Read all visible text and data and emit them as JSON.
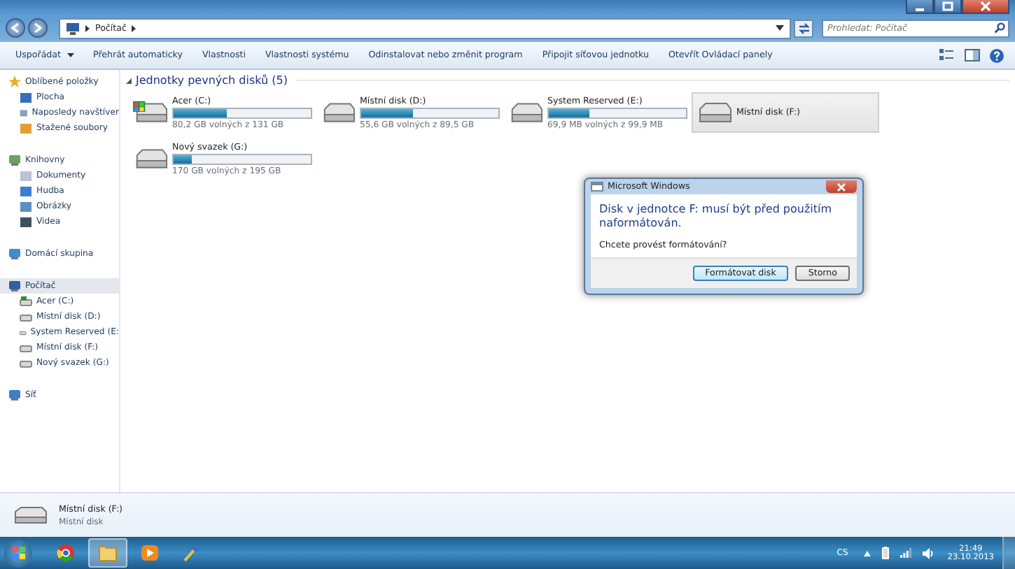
{
  "address_bar": {
    "path": "Počítač",
    "search_placeholder": "Prohledat: Počítač"
  },
  "toolbar": {
    "buttons": [
      {
        "label": "Uspořádat",
        "dropdown": true
      },
      {
        "label": "Přehrát automaticky",
        "dropdown": false
      },
      {
        "label": "Vlastnosti",
        "dropdown": false
      },
      {
        "label": "Vlastnosti systému",
        "dropdown": false
      },
      {
        "label": "Odinstalovat nebo změnit program",
        "dropdown": false
      },
      {
        "label": "Připojit síťovou jednotku",
        "dropdown": false
      },
      {
        "label": "Otevřít Ovládací panely",
        "dropdown": false
      }
    ]
  },
  "sidebar": {
    "groups": [
      {
        "label": "Oblíbené položky",
        "selected": false,
        "children": [
          {
            "label": "Plocha"
          },
          {
            "label": "Naposledy navštíver"
          },
          {
            "label": "Stažené soubory"
          }
        ]
      },
      {
        "label": "Knihovny",
        "selected": false,
        "children": [
          {
            "label": "Dokumenty"
          },
          {
            "label": "Hudba"
          },
          {
            "label": "Obrázky"
          },
          {
            "label": "Videa"
          }
        ]
      },
      {
        "label": "Domácí skupina",
        "selected": false
      },
      {
        "label": "Počítač",
        "selected": true,
        "children": [
          {
            "label": "Acer (C:)",
            "kind": "system"
          },
          {
            "label": "Místní disk (D:)",
            "kind": "disk"
          },
          {
            "label": "System Reserved (E:",
            "kind": "disk"
          },
          {
            "label": "Místní disk (F:)",
            "kind": "disk"
          },
          {
            "label": "Nový svazek (G:)",
            "kind": "disk"
          }
        ]
      },
      {
        "label": "Síť",
        "selected": false
      }
    ]
  },
  "section": {
    "title": "Jednotky pevných disků (5)"
  },
  "drives": [
    {
      "name": "Acer (C:)",
      "kind": "system",
      "level": 0.39,
      "free": "80,2 GB volných z 131 GB",
      "selected": false
    },
    {
      "name": "Místní disk (D:)",
      "kind": "disk",
      "level": 0.38,
      "free": "55,6 GB volných z 89,5 GB",
      "selected": false
    },
    {
      "name": "System Reserved (E:)",
      "kind": "disk",
      "level": 0.3,
      "free": "69,9 MB volných z 99,9 MB",
      "selected": false
    },
    {
      "name": "Místní disk (F:)",
      "kind": "unformatted",
      "selected": true
    },
    {
      "name": "Nový svazek (G:)",
      "kind": "disk",
      "level": 0.13,
      "free": "170 GB volných z 195 GB",
      "selected": false
    }
  ],
  "dialog": {
    "title": "Microsoft Windows",
    "message": "Disk v jednotce F: musí být před použitím naformátován.",
    "question": "Chcete provést formátování?",
    "buttons": [
      {
        "label": "Formátovat disk",
        "default": true
      },
      {
        "label": "Storno",
        "default": false
      }
    ]
  },
  "details": {
    "name": "Místní disk (F:)",
    "type": "Místní disk"
  },
  "taskbar": {
    "apps": [
      {
        "selected": false
      },
      {
        "selected": true
      },
      {
        "selected": false
      },
      {
        "selected": false
      }
    ],
    "language": "CS",
    "time": "21:49",
    "date": "23.10.2013"
  }
}
